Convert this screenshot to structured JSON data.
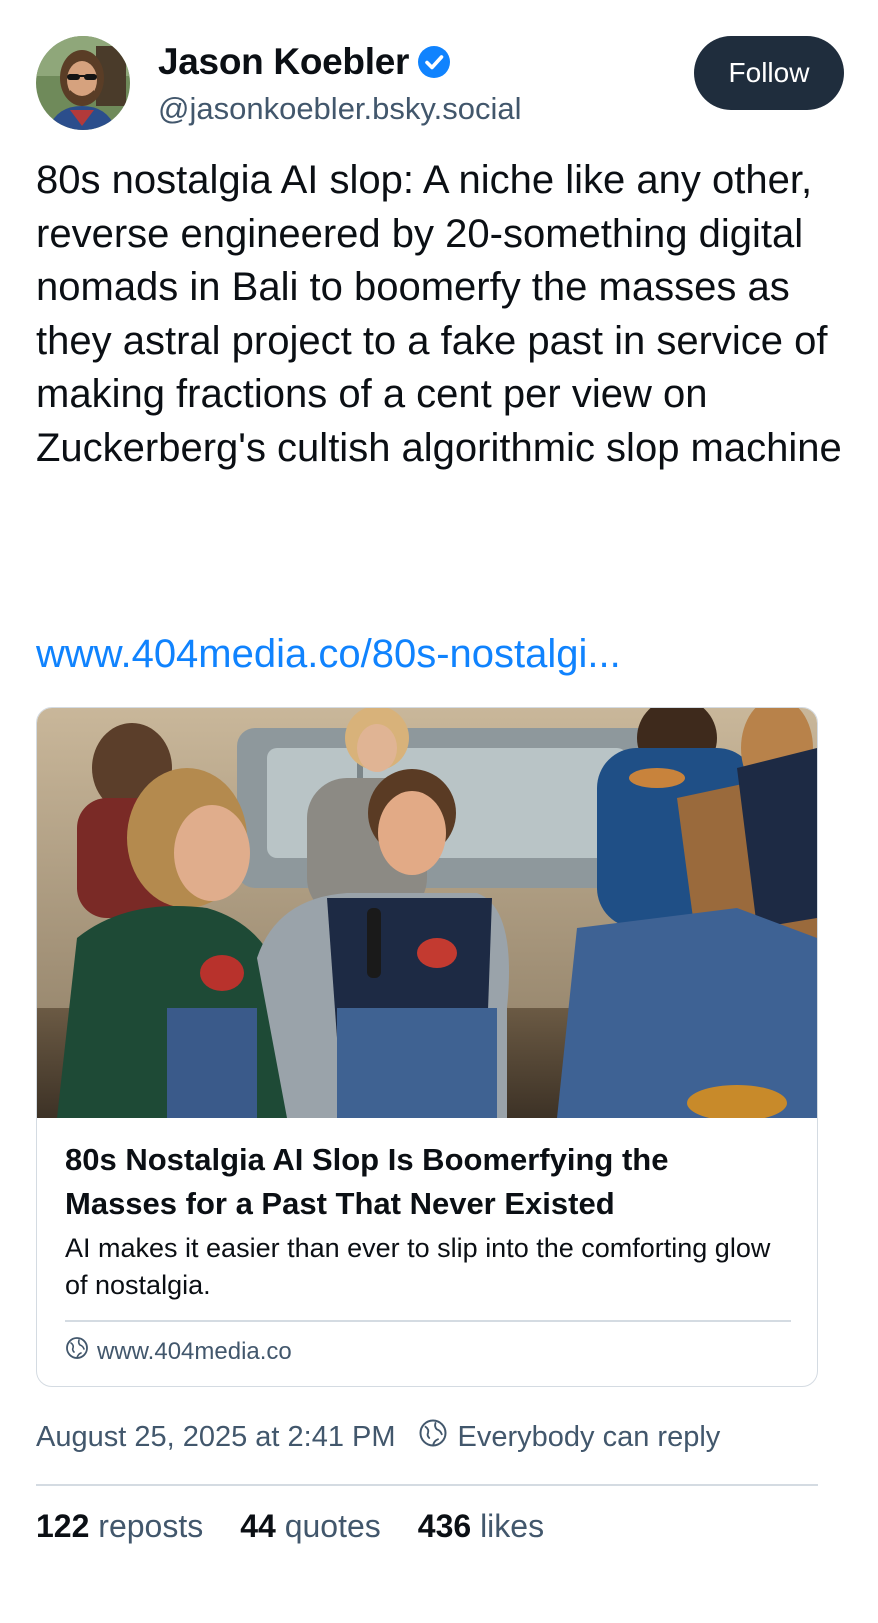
{
  "author": {
    "display_name": "Jason Koebler",
    "handle": "@jasonkoebler.bsky.social",
    "verified_icon": "verified-badge-icon"
  },
  "follow_button": {
    "label": "Follow"
  },
  "post": {
    "text": "80s nostalgia AI slop: A niche like any other, reverse engineered by 20-something digital nomads in Bali to boomerfy the masses as they astral project to a fake past in service of making fractions of a cent per view on Zuckerberg's cultish algorithmic slop machine",
    "link": "www.404media.co/80s-nostalgi..."
  },
  "embed": {
    "title": "80s Nostalgia AI Slop Is Boomerfying the Masses for a Past That Never Existed",
    "description": "AI makes it easier than ever to slip into the comforting glow of nostalgia.",
    "domain": "www.404media.co",
    "domain_icon": "globe-icon",
    "image_icon": "link-card-image"
  },
  "meta": {
    "timestamp": "August 25, 2025 at 2:41 PM",
    "reply_setting": "Everybody can reply",
    "reply_icon": "globe-icon"
  },
  "stats": {
    "reposts_count": "122",
    "reposts_label": "reposts",
    "quotes_count": "44",
    "quotes_label": "quotes",
    "likes_count": "436",
    "likes_label": "likes"
  },
  "colors": {
    "link": "#1083fe",
    "follow_bg": "#1f2d3d",
    "muted_text": "#42576c",
    "verified": "#1083fe",
    "border": "#d4dbe2"
  }
}
